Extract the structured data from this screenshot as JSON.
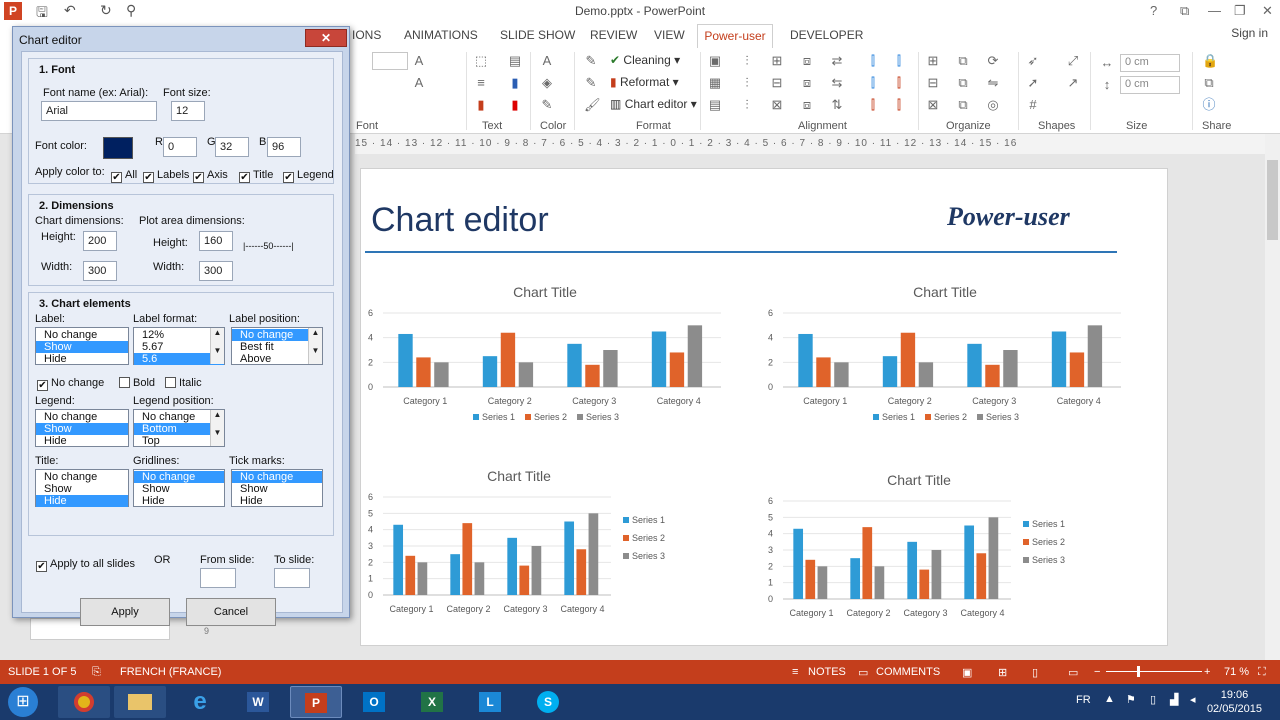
{
  "window": {
    "title": "Demo.pptx - PowerPoint",
    "sign_in": "Sign in",
    "help": "?"
  },
  "ribbon": {
    "tabs": [
      "IONS",
      "ANIMATIONS",
      "SLIDE SHOW",
      "REVIEW",
      "VIEW",
      "Power-user",
      "DEVELOPER"
    ],
    "groups": [
      "Font",
      "Text",
      "Color",
      "Format",
      "Alignment",
      "Organize",
      "Shapes",
      "Size",
      "Share"
    ],
    "format_buttons": [
      "Cleaning",
      "Reformat",
      "Chart editor"
    ],
    "size_values": [
      "0 cm",
      "0 cm"
    ]
  },
  "ruler": "15 · 14 · 13 · 12 · 11 · 10 · 9 · 8 · 7 · 6 · 5 · 4 · 3 · 2 · 1 · 0 · 1 · 2 · 3 · 4 · 5 · 6 · 7 · 8 · 9 · 10 · 11 · 12 · 13 · 14 · 15 · 16",
  "slide": {
    "title": "Chart editor",
    "logo_text": "Power-user",
    "side_ruler": "9"
  },
  "chart_data": [
    {
      "type": "bar",
      "title": "Chart Title",
      "categories": [
        "Category 1",
        "Category 2",
        "Category 3",
        "Category 4"
      ],
      "series": [
        {
          "name": "Series 1",
          "values": [
            4.3,
            2.5,
            3.5,
            4.5
          ]
        },
        {
          "name": "Series 2",
          "values": [
            2.4,
            4.4,
            1.8,
            2.8
          ]
        },
        {
          "name": "Series 3",
          "values": [
            2,
            2,
            3,
            5
          ]
        }
      ],
      "ylim": [
        0,
        6
      ],
      "yticks": [
        0,
        2,
        4,
        6
      ],
      "legend": "bottom"
    },
    {
      "type": "bar",
      "title": "Chart Title",
      "categories": [
        "Category 1",
        "Category 2",
        "Category 3",
        "Category 4"
      ],
      "series": [
        {
          "name": "Series 1",
          "values": [
            4.3,
            2.5,
            3.5,
            4.5
          ]
        },
        {
          "name": "Series 2",
          "values": [
            2.4,
            4.4,
            1.8,
            2.8
          ]
        },
        {
          "name": "Series 3",
          "values": [
            2,
            2,
            3,
            5
          ]
        }
      ],
      "ylim": [
        0,
        6
      ],
      "yticks": [
        0,
        2,
        4,
        6
      ],
      "legend": "bottom"
    },
    {
      "type": "bar",
      "title": "Chart Title",
      "categories": [
        "Category 1",
        "Category 2",
        "Category 3",
        "Category 4"
      ],
      "series": [
        {
          "name": "Series 1",
          "values": [
            4.3,
            2.5,
            3.5,
            4.5
          ]
        },
        {
          "name": "Series 2",
          "values": [
            2.4,
            4.4,
            1.8,
            2.8
          ]
        },
        {
          "name": "Series 3",
          "values": [
            2,
            2,
            3,
            5
          ]
        }
      ],
      "ylim": [
        0,
        6
      ],
      "yticks": [
        0,
        1,
        2,
        3,
        4,
        5,
        6
      ],
      "legend": "right"
    },
    {
      "type": "bar",
      "title": "Chart Title",
      "categories": [
        "Category 1",
        "Category 2",
        "Category 3",
        "Category 4"
      ],
      "series": [
        {
          "name": "Series 1",
          "values": [
            4.3,
            2.5,
            3.5,
            4.5
          ]
        },
        {
          "name": "Series 2",
          "values": [
            2.4,
            4.4,
            1.8,
            2.8
          ]
        },
        {
          "name": "Series 3",
          "values": [
            2,
            2,
            3,
            5
          ]
        }
      ],
      "ylim": [
        0,
        6
      ],
      "yticks": [
        0,
        1,
        2,
        3,
        4,
        5,
        6
      ],
      "legend": "right"
    }
  ],
  "colors": {
    "series1": "#2e9bd6",
    "series2": "#e0632a",
    "series3": "#8c8c8c",
    "accent": "#c43e1c",
    "font_color": "#002060"
  },
  "status": {
    "slide": "SLIDE 1 OF 5",
    "language": "FRENCH (FRANCE)",
    "notes": "NOTES",
    "comments": "COMMENTS",
    "zoom": "71 %"
  },
  "taskbar": {
    "lang": "FR",
    "time": "19:06",
    "date": "02/05/2015"
  },
  "dialog": {
    "title": "Chart editor",
    "close": "✕",
    "font": {
      "section": "1. Font",
      "name_label": "Font name (ex: Arial):",
      "name_value": "Arial",
      "size_label": "Font size:",
      "size_value": "12",
      "color_label": "Font color:",
      "r_label": "R",
      "r": "0",
      "g_label": "G",
      "g": "32",
      "b_label": "B",
      "b": "96",
      "apply_label": "Apply color to:",
      "targets": [
        "All",
        "Labels",
        "Axis",
        "Title",
        "Legend"
      ]
    },
    "dimensions": {
      "section": "2. Dimensions",
      "chart_label": "Chart dimensions:",
      "plot_label": "Plot area dimensions:",
      "height_label": "Height:",
      "width_label": "Width:",
      "chart_height": "200",
      "chart_width": "300",
      "plot_height": "160",
      "plot_width": "300",
      "scale": "|------50------|"
    },
    "elements": {
      "section": "3. Chart elements",
      "label": {
        "title": "Label:",
        "items": [
          "No change",
          "Show",
          "Hide"
        ],
        "selected": 1
      },
      "label_format": {
        "title": "Label format:",
        "items": [
          "12%",
          "5.67",
          "5.6"
        ],
        "selected": 2
      },
      "label_position": {
        "title": "Label position:",
        "items": [
          "No change",
          "Best fit",
          "Above"
        ],
        "selected": 0
      },
      "no_change": "No change",
      "bold": "Bold",
      "italic": "Italic",
      "legend": {
        "title": "Legend:",
        "items": [
          "No change",
          "Show",
          "Hide"
        ],
        "selected": 1
      },
      "legend_position": {
        "title": "Legend position:",
        "items": [
          "No change",
          "Bottom",
          "Top"
        ],
        "selected": 1
      },
      "title_list": {
        "title": "Title:",
        "items": [
          "No change",
          "Show",
          "Hide"
        ],
        "selected": 2
      },
      "gridlines": {
        "title": "Gridlines:",
        "items": [
          "No change",
          "Show",
          "Hide"
        ],
        "selected": 0
      },
      "tick_marks": {
        "title": "Tick marks:",
        "items": [
          "No change",
          "Show",
          "Hide"
        ],
        "selected": 0
      }
    },
    "apply_all": "Apply to all slides",
    "or": "OR",
    "from_slide": "From slide:",
    "to_slide": "To slide:",
    "apply": "Apply",
    "cancel": "Cancel"
  }
}
